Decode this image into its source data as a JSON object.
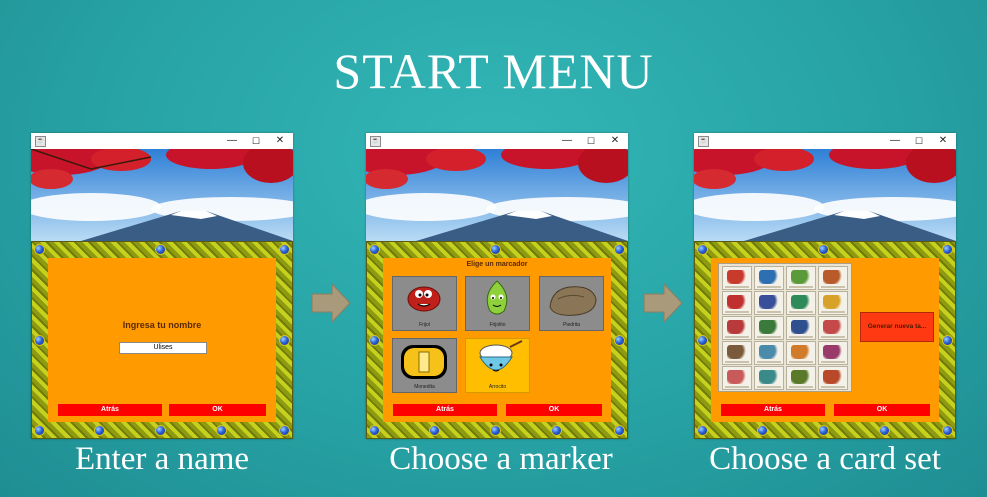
{
  "title": "START MENU",
  "captions": [
    "Enter a name",
    "Choose a marker",
    "Choose a card set"
  ],
  "icons": {
    "arrow": "right-arrow-icon",
    "window_icon": "java-app-icon",
    "minimize": "minimize-icon",
    "maximize": "maximize-icon",
    "close": "close-icon"
  },
  "colors": {
    "background": "#2aa6a8",
    "panel": "#ff9a00",
    "button": "#ff0000",
    "selected_marker": "#ffbf00",
    "arrow": "#a89a7a"
  },
  "window_controls": {
    "minimize": "—",
    "maximize": "☐",
    "close": "✕"
  },
  "screen1": {
    "label": "Ingresa tu nombre",
    "name_value": "Ulises",
    "back_label": "Atrás",
    "ok_label": "OK"
  },
  "screen2": {
    "heading": "Elige un marcador",
    "markers": [
      {
        "name": "Frijol",
        "icon": "bean-icon",
        "selected": false
      },
      {
        "name": "Frijolito",
        "icon": "leaf-sprout-icon",
        "selected": false
      },
      {
        "name": "Piedrita",
        "icon": "stone-icon",
        "selected": false
      },
      {
        "name": "Monedita",
        "icon": "coin-icon",
        "selected": false
      },
      {
        "name": "Arrocito",
        "icon": "rice-bowl-icon",
        "selected": true
      }
    ],
    "back_label": "Atrás",
    "ok_label": "OK"
  },
  "screen3": {
    "generate_label": "Generar nueva ta...",
    "back_label": "Atrás",
    "ok_label": "OK",
    "card_colors": [
      "#c83a2c",
      "#2d6fb0",
      "#5a9a3a",
      "#b85a2a",
      "#c0302e",
      "#3a4f9a",
      "#2f8a5a",
      "#d8a22a",
      "#b83a3a",
      "#3a7a3a",
      "#2f4f8f",
      "#c44a4a",
      "#7a5a3a",
      "#4a8aaa",
      "#d07a2a",
      "#9a3a6a",
      "#c85a5a",
      "#3a8a8a",
      "#5a7a2a",
      "#b84a2a"
    ]
  }
}
